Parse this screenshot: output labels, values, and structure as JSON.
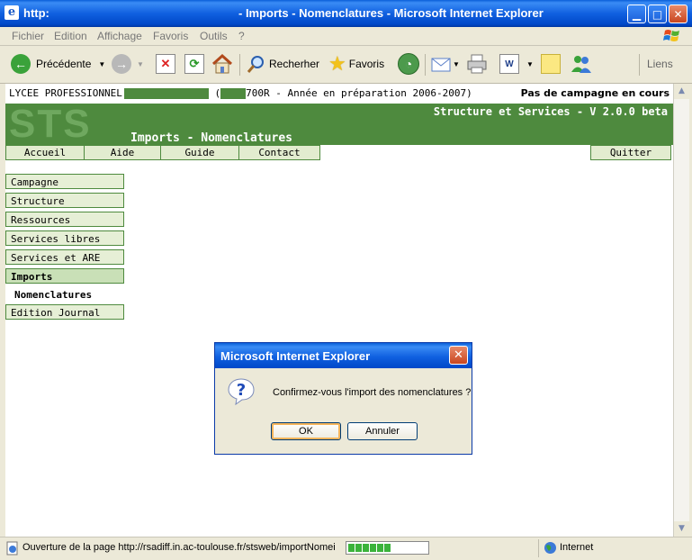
{
  "window": {
    "title_left": "http:",
    "title_center": "- Imports - Nomenclatures - Microsoft Internet Explorer"
  },
  "menu": [
    "Fichier",
    "Edition",
    "Affichage",
    "Favoris",
    "Outils",
    "?"
  ],
  "toolbar": {
    "back_label": "Précédente",
    "search_label": "Recherher",
    "favorites_label": "Favoris",
    "links_label": "Liens"
  },
  "page": {
    "school_prefix": "LYCEE PROFESSIONNEL",
    "school_paren_open": "(",
    "school_code_suffix": "700R - Année en préparation 2006-2007)",
    "campaign_status": "Pas de campagne en cours",
    "logo_text": "STS",
    "app_subtitle": "Structure et Services - V 2.0.0 beta",
    "page_title": "Imports - Nomenclatures",
    "accent_color": "#4e8a3e"
  },
  "nav": {
    "accueil": "Accueil",
    "aide": "Aide",
    "guide": "Guide",
    "contact": "Contact",
    "quitter": "Quitter"
  },
  "sidebar": {
    "campagne": "Campagne",
    "structure": "Structure",
    "ressources": "Ressources",
    "services_libres": "Services libres",
    "services_are": "Services et ARE",
    "imports": "Imports",
    "nomenclatures": "Nomenclatures",
    "edition_journal": "Edition Journal"
  },
  "dialog": {
    "title": "Microsoft Internet Explorer",
    "message": "Confirmez-vous l'import des nomenclatures ?",
    "ok_label": "OK",
    "cancel_label": "Annuler"
  },
  "status": {
    "text": "Ouverture de la page http://rsadiff.in.ac-toulouse.fr/stsweb/importNomei",
    "zone": "Internet"
  }
}
